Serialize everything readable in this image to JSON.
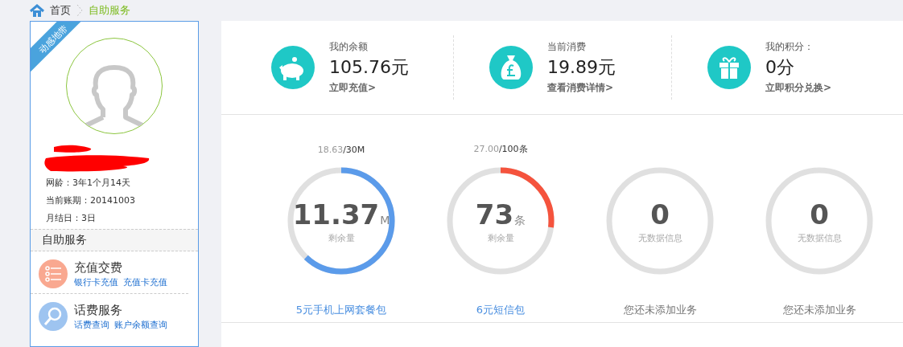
{
  "breadcrumb": {
    "items": [
      {
        "label": "首页",
        "kind": "home"
      },
      {
        "label": "自助服务",
        "kind": "current"
      }
    ]
  },
  "sidebar": {
    "ribbon": "动感地带",
    "info": [
      "网龄：3年1个月14天",
      "当前账期：20141003",
      "月结日：3日"
    ],
    "section_title": "自助服务",
    "services": [
      {
        "kind": "list",
        "title": "充值交费",
        "links": [
          "银行卡充值",
          "充值卡充值"
        ]
      },
      {
        "kind": "search",
        "title": "话费服务",
        "links": [
          "话费查询",
          "账户余额查询"
        ]
      }
    ]
  },
  "stats": [
    {
      "kind": "piggy",
      "label": "我的余额",
      "value": "105.76元",
      "link": "立即充值>"
    },
    {
      "kind": "bag",
      "label": "当前消费",
      "value": "19.89元",
      "link": "查看消费详情>"
    },
    {
      "kind": "gift",
      "label": "我的积分：",
      "value": "0分",
      "link": "立即积分兑换>"
    }
  ],
  "meters": [
    {
      "used": "18.63",
      "total": "/30M",
      "level": 0.621,
      "color": "#5b9bea",
      "value": "11.37",
      "unit": "M",
      "caption": "剩余量",
      "package": "5元手机上网套餐包",
      "package_added": true
    },
    {
      "used": "27.00",
      "total": "/100条",
      "level": 0.27,
      "color": "#f5533d",
      "value": "73",
      "unit": "条",
      "caption": "剩余量",
      "package": "6元短信包",
      "package_added": true
    },
    {
      "value": "0",
      "caption": "无数据信息",
      "package": "您还未添加业务",
      "package_added": false
    },
    {
      "value": "0",
      "caption": "无数据信息",
      "package": "您还未添加业务",
      "package_added": false
    }
  ]
}
